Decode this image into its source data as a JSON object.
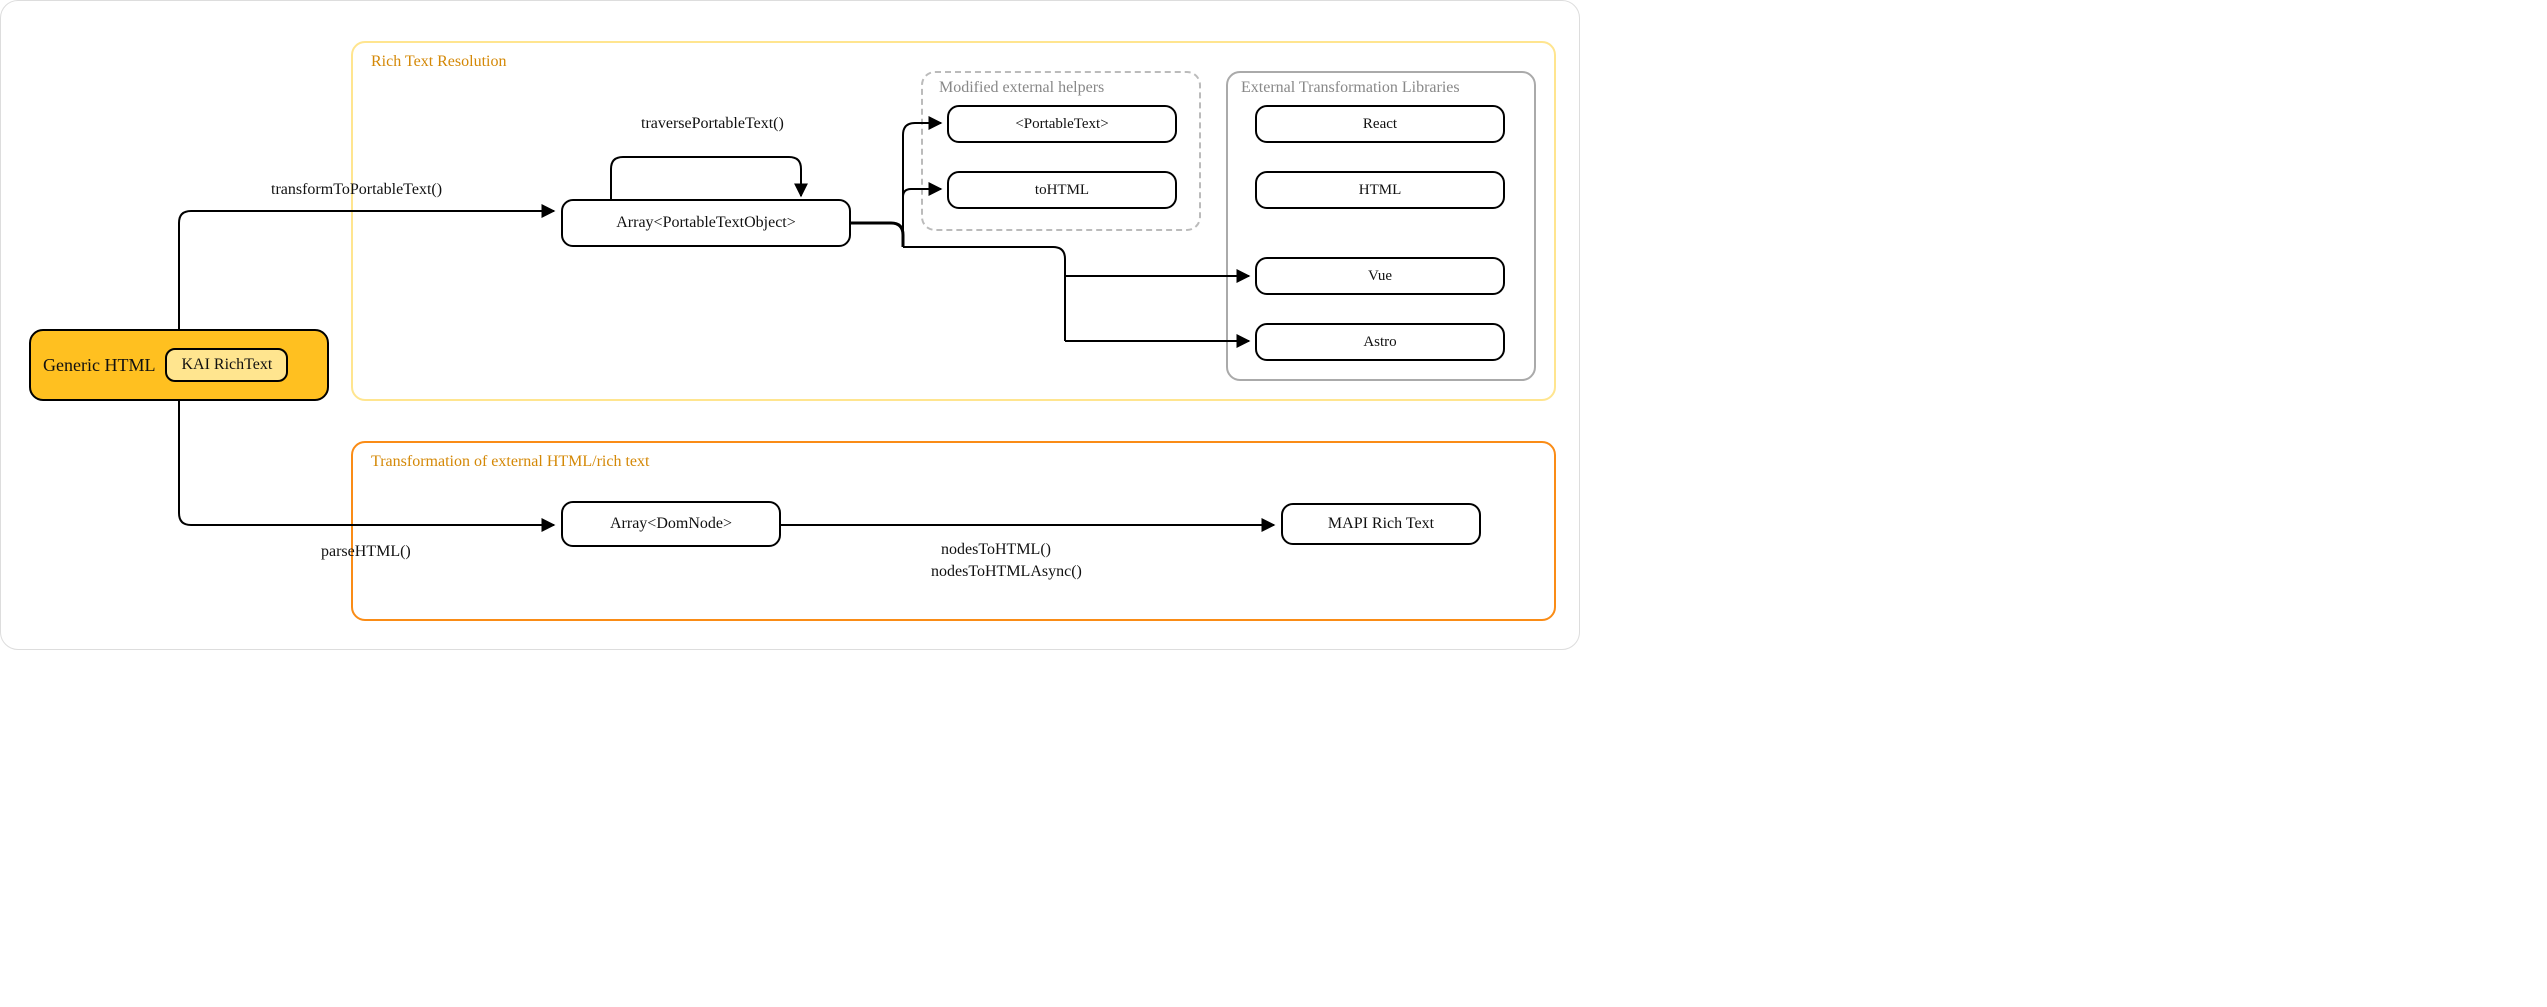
{
  "groups": {
    "resolution_title": "Rich Text Resolution",
    "transform_title": "Transformation of external HTML/rich text",
    "helpers_title": "Modified external helpers",
    "ext_libs_title": "External Transformation Libraries"
  },
  "source": {
    "outer": "Generic HTML",
    "inner": "KAI RichText"
  },
  "nodes": {
    "array_pt": "Array<PortableTextObject>",
    "portable_text": "<PortableText>",
    "to_html": "toHTML",
    "react": "React",
    "html": "HTML",
    "vue": "Vue",
    "astro": "Astro",
    "array_dom": "Array<DomNode>",
    "mapi": "MAPI Rich Text"
  },
  "edges": {
    "transform_to_pt": "transformToPortableText()",
    "traverse_pt": "traversePortableText()",
    "parse_html": "parseHTML()",
    "nodes_to_html_1": "nodesToHTML()",
    "nodes_to_html_2": "nodesToHTMLAsync()"
  }
}
